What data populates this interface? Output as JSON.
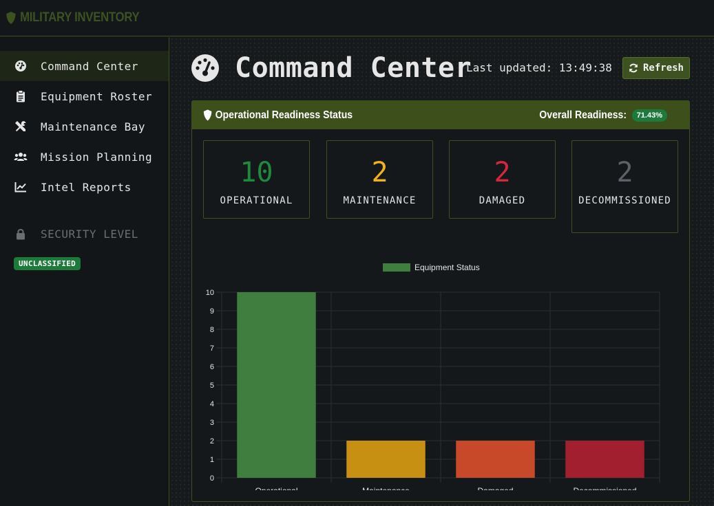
{
  "brand": {
    "name": "MILITARY INVENTORY",
    "icon": "shield-icon"
  },
  "sidebar": {
    "items": [
      {
        "label": "Command Center",
        "icon": "gauge-icon",
        "active": true
      },
      {
        "label": "Equipment Roster",
        "icon": "clipboard-icon",
        "active": false
      },
      {
        "label": "Maintenance Bay",
        "icon": "tools-icon",
        "active": false
      },
      {
        "label": "Mission Planning",
        "icon": "users-icon",
        "active": false
      },
      {
        "label": "Intel Reports",
        "icon": "line-chart-icon",
        "active": false
      }
    ],
    "security": {
      "label": "SECURITY LEVEL",
      "icon": "lock-icon",
      "badge": "UNCLASSIFIED"
    }
  },
  "header": {
    "title": "Command Center",
    "last_updated_label": "Last updated:",
    "last_updated_time": "13:49:38",
    "refresh_label": "Refresh"
  },
  "panel": {
    "title": "Operational Readiness Status",
    "readiness_label": "Overall Readiness:",
    "readiness_value": "71.43%"
  },
  "stats": [
    {
      "value": "10",
      "label": "OPERATIONAL",
      "color": "#1f8a3e"
    },
    {
      "value": "2",
      "label": "MAINTENANCE",
      "color": "#f2b318"
    },
    {
      "value": "2",
      "label": "DAMAGED",
      "color": "#d7263d"
    },
    {
      "value": "2",
      "label": "DECOMMISSIONED",
      "color": "#5c6268"
    }
  ],
  "colors": {
    "accent": "#3d5220",
    "success": "#1c7a3a"
  },
  "chart_data": {
    "type": "bar",
    "categories": [
      "Operational",
      "Maintenance",
      "Damaged",
      "Decommissioned"
    ],
    "series": [
      {
        "name": "Equipment Status",
        "values": [
          10,
          2,
          2,
          2
        ]
      }
    ],
    "bar_colors": [
      "#3f7e3e",
      "#c89013",
      "#c8482a",
      "#a21f2f"
    ],
    "ylim": [
      0,
      10
    ],
    "yticks": [
      0,
      1,
      2,
      3,
      4,
      5,
      6,
      7,
      8,
      9,
      10
    ],
    "grid": true,
    "legend": "top"
  }
}
